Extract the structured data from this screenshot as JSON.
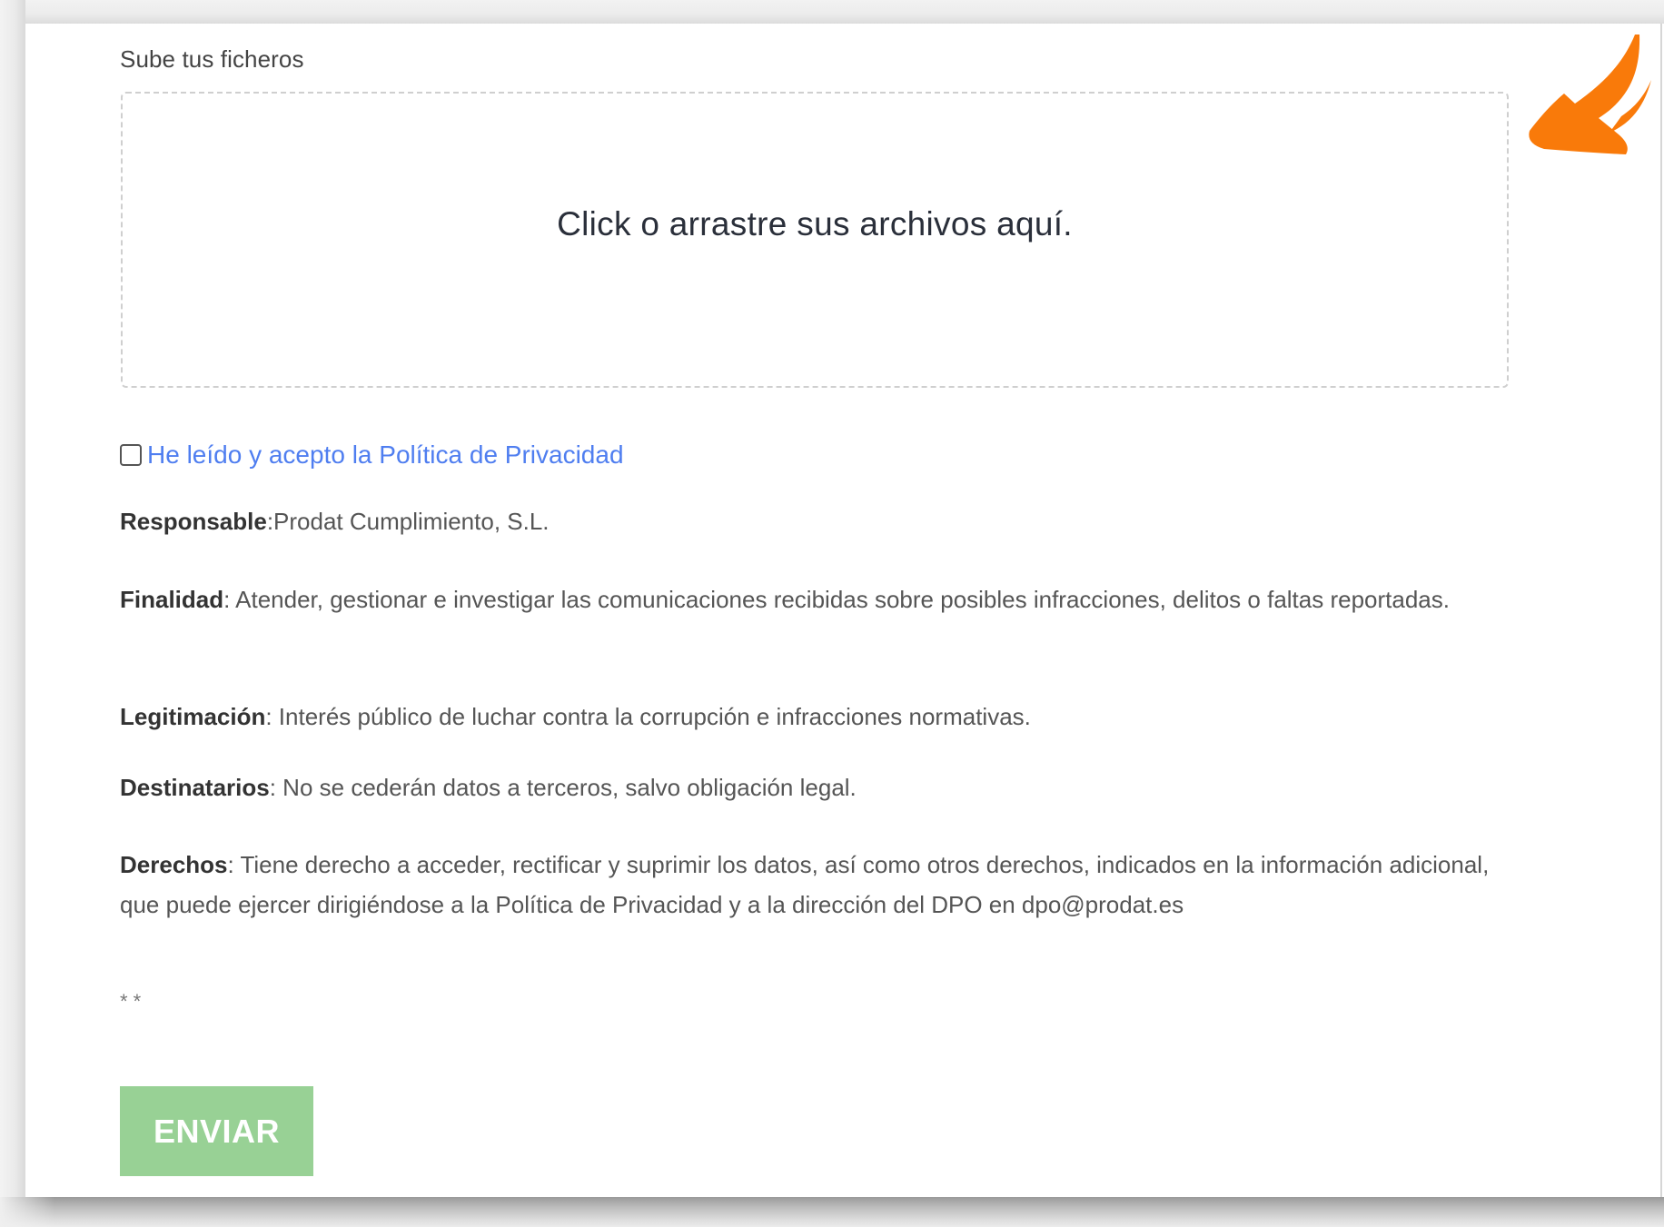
{
  "upload": {
    "label": "Sube tus ficheros",
    "dropzone_text": "Click o arrastre sus archivos aquí."
  },
  "consent": {
    "checked": false,
    "link_text": "He leído y acepto la Política de Privacidad"
  },
  "info": {
    "responsable": {
      "label": "Responsable",
      "text": ":Prodat Cumplimiento, S.L."
    },
    "finalidad": {
      "label": "Finalidad",
      "text": ": Atender, gestionar e investigar las comunicaciones recibidas sobre posibles infracciones, delitos o faltas reportadas."
    },
    "legitimacion": {
      "label": "Legitimación",
      "text": ": Interés público de luchar contra la corrupción e infracciones normativas."
    },
    "destinatarios": {
      "label": "Destinatarios",
      "text": ": No se cederán datos a terceros, salvo obligación legal."
    },
    "derechos": {
      "label": "Derechos",
      "text": ": Tiene derecho a acceder, rectificar y suprimir los datos, así como otros derechos, indicados en la información adicional, que puede ejercer dirigiéndose a la Política de Privacidad y a la dirección del DPO en dpo@prodat.es"
    }
  },
  "required_marks": "* *",
  "submit": {
    "label": "ENVIAR"
  },
  "colors": {
    "link": "#4f7ef0",
    "submit_bg": "#98d195",
    "arrow": "#f97a0a"
  },
  "icons": {
    "annotation_arrow": "arrow-icon"
  }
}
